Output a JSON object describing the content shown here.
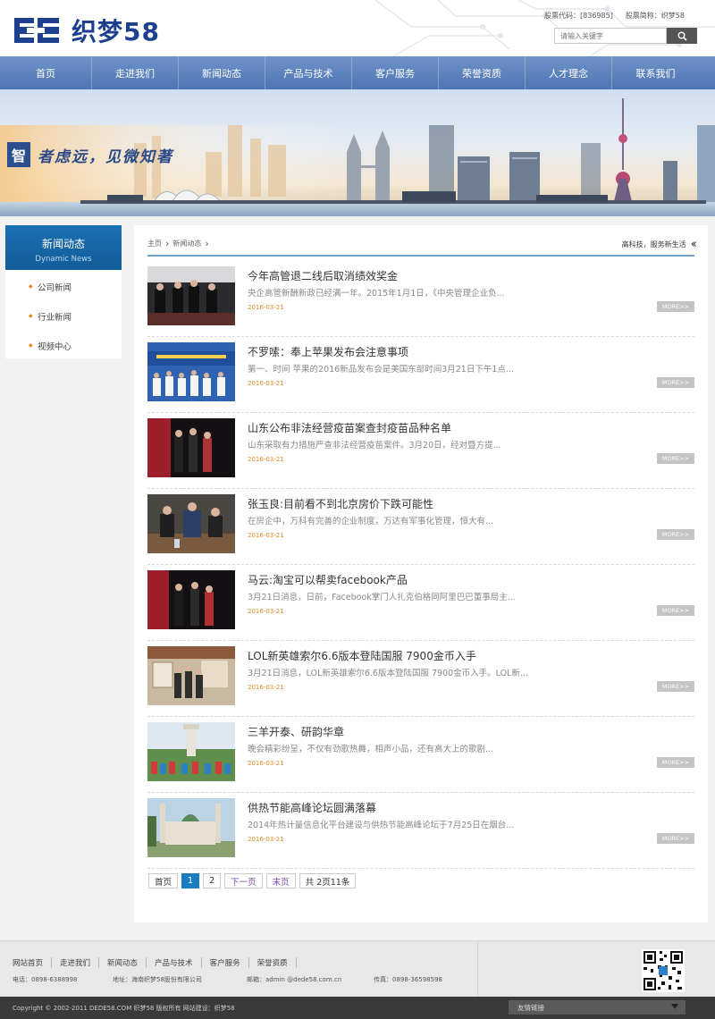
{
  "header": {
    "logo_text": "织梦58",
    "stock_code": "股票代码：[836985]",
    "stock_abbr": "股票简称：织梦58",
    "search_placeholder": "请输入关键字"
  },
  "nav": [
    "首页",
    "走进我们",
    "新闻动态",
    "产品与技术",
    "客户服务",
    "荣誉资质",
    "人才理念",
    "联系我们"
  ],
  "banner": {
    "mark": "智",
    "slogan": "者虑远，见微知著"
  },
  "sidebar": {
    "title": "新闻动态",
    "subtitle": "Dynamic News",
    "items": [
      "公司新闻",
      "行业新闻",
      "视频中心"
    ]
  },
  "breadcrumb": {
    "home": "主页",
    "current": "新闻动态",
    "tagline": "高科技，服务新生活"
  },
  "more_label": "MORE>>",
  "news": [
    {
      "title": "今年高管退二线后取消绩效奖金",
      "summary": "央企高管新酬新政已经满一年。2015年1月1日，《中央管理企业负...",
      "date": "2016-03-21"
    },
    {
      "title": "不罗嗦：奉上苹果发布会注意事项",
      "summary": "第一、时间 苹果的2016新品发布会是美国东部时间3月21日下午1点...",
      "date": "2016-03-21"
    },
    {
      "title": "山东公布非法经营疫苗案查封疫苗品种名单",
      "summary": "山东采取有力措施严查非法经营疫苗案件。3月20日，经对暨方提...",
      "date": "2016-03-21"
    },
    {
      "title": "张玉良:目前看不到北京房价下跌可能性",
      "summary": "在房企中，万科有完善的企业制度，万达有军事化管理，恒大有...",
      "date": "2016-03-21"
    },
    {
      "title": "马云:淘宝可以帮卖facebook产品",
      "summary": "3月21日消息，日前，Facebook掌门人扎克伯格同阿里巴巴董事局主...",
      "date": "2016-03-21"
    },
    {
      "title": "LOL新英雄索尔6.6版本登陆国服 7900金币入手",
      "summary": "3月21日消息，LOL新英雄索尔6.6版本登陆国服 7900金币入手。LOL新...",
      "date": "2016-03-21"
    },
    {
      "title": "三羊开泰、研韵华章",
      "summary": "晚会精彩纷呈，不仅有劲歌热舞，相声小品，还有高大上的歌剧...",
      "date": "2016-03-21"
    },
    {
      "title": "供热节能高峰论坛圆满落幕",
      "summary": "2014年热计量信息化平台建设与供热节能高峰论坛于7月25日在烟台...",
      "date": "2016-03-21"
    }
  ],
  "pager": {
    "first": "首页",
    "pages": [
      "1",
      "2"
    ],
    "next": "下一页",
    "last": "末页",
    "info_prefix": "共",
    "info_pages": "2页11条"
  },
  "footer": {
    "links": [
      "网站首页",
      "走进我们",
      "新闻动态",
      "产品与技术",
      "客户服务",
      "荣誉资质"
    ],
    "phone": "电话：0898-6388998",
    "address": "地址：海南织梦58股份有限公司",
    "email": "邮箱：admin @dede58.com.cn",
    "fax": "传真：0898-36598598",
    "copyright": "Copyright © 2002-2011 DEDE58.COM 织梦58 版权所有 网站建设：织梦58",
    "friend_links": "友情链接"
  },
  "colors": {
    "brand": "#1c3f8f",
    "nav": "#5a7fbd",
    "accent": "#1a7cc1",
    "date": "#e08a24"
  }
}
